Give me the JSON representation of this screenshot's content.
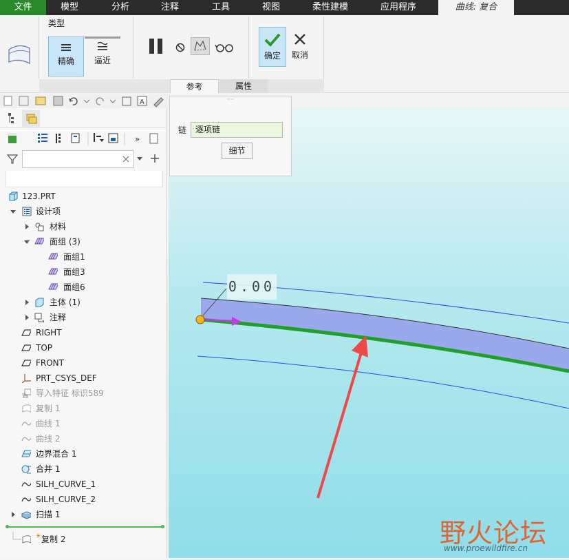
{
  "menubar": {
    "items": [
      "文件",
      "模型",
      "分析",
      "注释",
      "工具",
      "视图",
      "柔性建模",
      "应用程序"
    ],
    "context_tab": "曲线: 复合"
  },
  "ribbon": {
    "type_group_label": "类型",
    "exact_label": "精确",
    "approx_label": "逼近",
    "ok_label": "确定",
    "cancel_label": "取消",
    "tabs": [
      "参考",
      "属性"
    ]
  },
  "chain_panel": {
    "chain_label": "链",
    "chain_value": "逐项链",
    "details_button": "细节"
  },
  "model_tree": {
    "search_placeholder": "",
    "items": [
      {
        "label": "123.PRT"
      },
      {
        "label": "设计项"
      },
      {
        "label": "材料"
      },
      {
        "label": "面组 (3)"
      },
      {
        "label": "面组1"
      },
      {
        "label": "面组3"
      },
      {
        "label": "面组6"
      },
      {
        "label": "主体 (1)"
      },
      {
        "label": "注释"
      },
      {
        "label": "RIGHT"
      },
      {
        "label": "TOP"
      },
      {
        "label": "FRONT"
      },
      {
        "label": "PRT_CSYS_DEF"
      },
      {
        "label": "导入特征 标识589"
      },
      {
        "label": "复制 1"
      },
      {
        "label": "曲线 1"
      },
      {
        "label": "曲线 2"
      },
      {
        "label": "边界混合 1"
      },
      {
        "label": "合并 1"
      },
      {
        "label": "SILH_CURVE_1"
      },
      {
        "label": "SILH_CURVE_2"
      },
      {
        "label": "扫描 1"
      },
      {
        "label": "复制 2"
      }
    ]
  },
  "graphics": {
    "dimension_value": "0.00"
  },
  "watermark": {
    "text": "野火论坛",
    "url": "www.proewildfire.cn"
  },
  "colors": {
    "menubar_bg": "#2b2b2b",
    "file_menu_bg": "#2a8a2a",
    "selected_button_bg": "#c8e6f8",
    "surface_fill": "#9aa8ec",
    "chain_green": "#1ea02a",
    "arrow_red": "#f04848"
  }
}
